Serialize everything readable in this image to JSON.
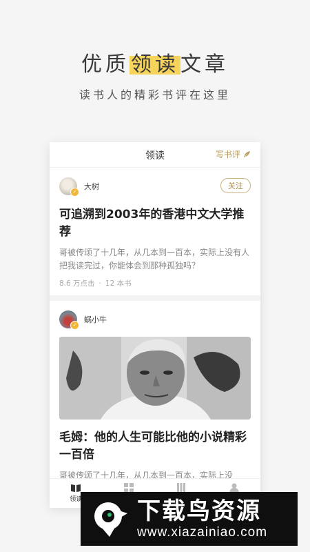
{
  "promo": {
    "title_before": "优质",
    "title_highlight": "领读",
    "title_after": "文章",
    "subtitle": "读书人的精彩书评在这里"
  },
  "topbar": {
    "title": "领读",
    "write_label": "写书评"
  },
  "posts": [
    {
      "author": "大树",
      "follow_label": "关注",
      "title": "可追溯到2003年的香港中文大学推荐",
      "excerpt": "哥被传颂了十几年，从几本到一百本，实际上没有人把我读完过，你能体会到那种孤独吗？",
      "views": "8.6 万点击",
      "separator": "·",
      "books": "12 本书"
    },
    {
      "author": "蜗小牛",
      "title": "毛姆：他的人生可能比他的小说精彩一百倍",
      "excerpt": "哥被传颂了十几年，从几本到一百本，实际上没"
    }
  ],
  "bottom_nav": {
    "items": [
      {
        "label": "领读",
        "icon": "book-open-icon"
      },
      {
        "label": "",
        "icon": "grid-icon"
      },
      {
        "label": "",
        "icon": "bookshelf-icon"
      },
      {
        "label": "",
        "icon": "person-icon"
      }
    ]
  },
  "watermark": {
    "main": "下载鸟资源",
    "url": "www.xiazainiao.com"
  },
  "colors": {
    "highlight": "#f6d35b",
    "accent_gold": "#b89a5a",
    "badge": "#f0b73a"
  }
}
